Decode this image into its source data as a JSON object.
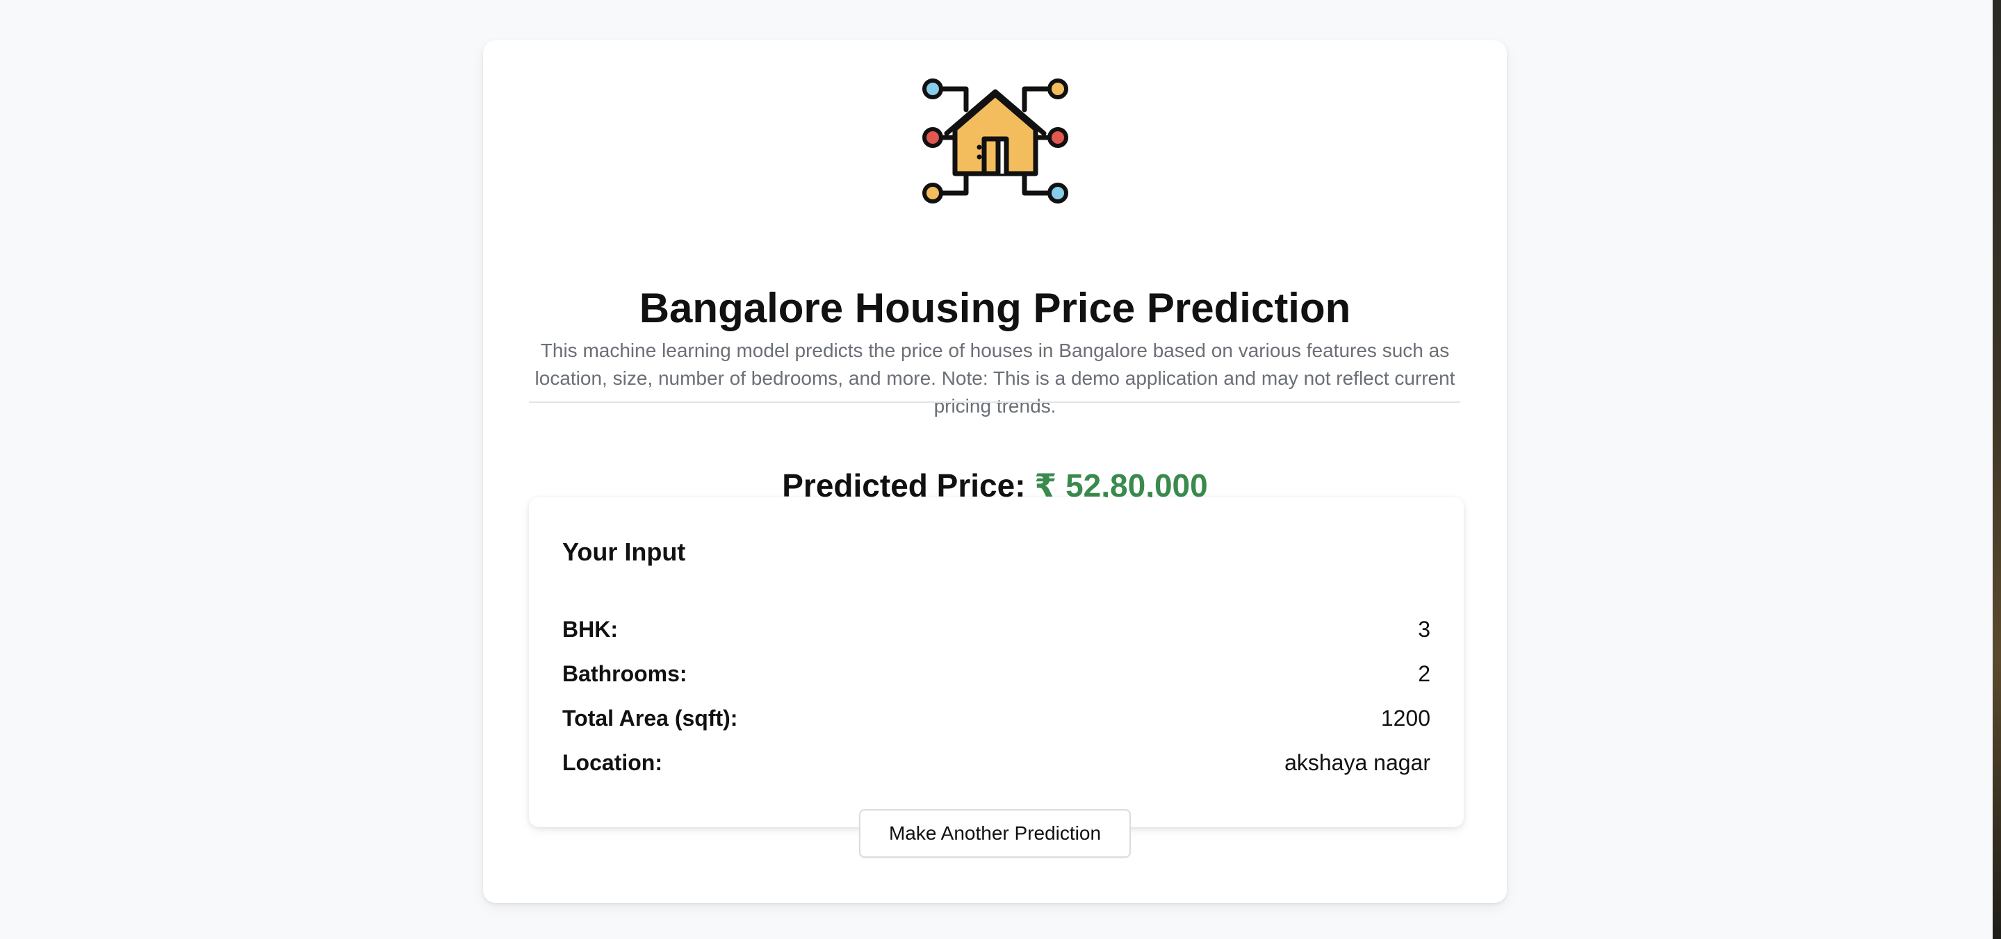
{
  "header": {
    "logo_icon": "smart-home-network-icon",
    "title": "Bangalore Housing Price Prediction",
    "description": "This machine learning model predicts the price of houses in Bangalore based on various features such as location, size, number of bedrooms, and more. Note: This is a demo application and may not reflect current pricing trends."
  },
  "prediction": {
    "label": "Predicted Price:",
    "value": "₹ 52,80,000",
    "value_color": "#3a8a4e"
  },
  "input_summary": {
    "title": "Your Input",
    "rows": [
      {
        "label": "BHK:",
        "value": "3"
      },
      {
        "label": "Bathrooms:",
        "value": "2"
      },
      {
        "label": "Total Area (sqft):",
        "value": "1200"
      },
      {
        "label": "Location:",
        "value": "akshaya nagar"
      }
    ]
  },
  "actions": {
    "new_prediction_label": "Make Another Prediction"
  },
  "colors": {
    "background": "#f8f9fb",
    "card": "#ffffff",
    "muted_text": "#6b6f76",
    "house_fill": "#f3bd5e",
    "node_blue": "#88cdec",
    "node_red": "#e0584f",
    "node_yellow": "#f3bd5e"
  }
}
